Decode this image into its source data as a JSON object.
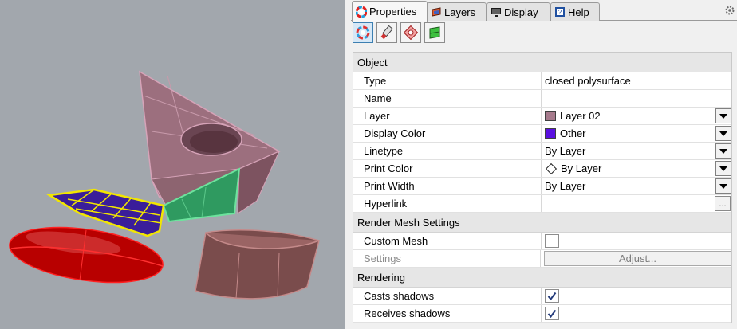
{
  "tabs": [
    {
      "label": "Properties",
      "icon": "color-wheel-icon",
      "active": true
    },
    {
      "label": "Layers",
      "icon": "layers-icon",
      "active": false
    },
    {
      "label": "Display",
      "icon": "monitor-icon",
      "active": false
    },
    {
      "label": "Help",
      "icon": "help-icon",
      "active": false
    }
  ],
  "toolbar": [
    {
      "icon": "object-properties-icon"
    },
    {
      "icon": "material-icon"
    },
    {
      "icon": "decal-icon"
    },
    {
      "icon": "texture-mapping-icon"
    }
  ],
  "sections": {
    "object": "Object",
    "render_mesh": "Render Mesh Settings",
    "rendering": "Rendering"
  },
  "object": {
    "type_label": "Type",
    "type_value": "closed polysurface",
    "name_label": "Name",
    "name_value": "",
    "layer_label": "Layer",
    "layer_value": "Layer 02",
    "layer_color": "#a67a8c",
    "display_color_label": "Display Color",
    "display_color_value": "Other",
    "display_color": "#5a10e0",
    "linetype_label": "Linetype",
    "linetype_value": "By Layer",
    "print_color_label": "Print Color",
    "print_color_value": "By Layer",
    "print_width_label": "Print Width",
    "print_width_value": "By Layer",
    "hyperlink_label": "Hyperlink",
    "hyperlink_button": "..."
  },
  "render_mesh": {
    "custom_mesh_label": "Custom Mesh",
    "custom_mesh_checked": false,
    "settings_label": "Settings",
    "adjust_button": "Adjust..."
  },
  "rendering": {
    "casts_shadows_label": "Casts shadows",
    "casts_shadows_checked": true,
    "receives_shadows_label": "Receives shadows",
    "receives_shadows_checked": true
  },
  "colors": {
    "viewport_bg": "#a2a7ad",
    "panel_bg": "#f0f0f0",
    "selection_yellow": "#f2e600",
    "selected_surface": "#3a1d9a",
    "ellipsoid_red": "#c00000",
    "pink_edge": "#c890a8"
  }
}
